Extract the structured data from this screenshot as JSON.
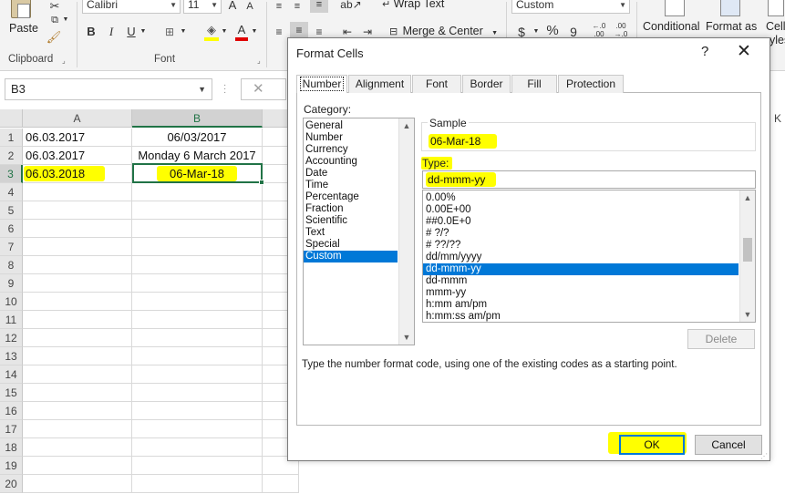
{
  "ribbon": {
    "paste_label": "Paste",
    "clipboard_label": "Clipboard",
    "font_group_label": "Font",
    "font_name": "Calibri",
    "font_size": "11",
    "bold": "B",
    "italic": "I",
    "underline": "U",
    "grow_font": "A",
    "shrink_font": "A",
    "font_color_letter": "A",
    "wrap_text": "Wrap Text",
    "merge_center": "Merge & Center",
    "number_format": "Custom",
    "currency_symbol": "$",
    "percent_symbol": "%",
    "comma_symbol": "9",
    "conditional_label": "Conditional",
    "format_as_label": "Format as",
    "cell_label": "Cell",
    "styles_label": "yles"
  },
  "formula_bar": {
    "name_box": "B3",
    "cancel_glyph": "✕"
  },
  "grid": {
    "columns": [
      "A",
      "B"
    ],
    "rows": [
      "1",
      "2",
      "3",
      "4",
      "5",
      "6",
      "7",
      "8",
      "9",
      "10",
      "11",
      "12",
      "13",
      "14",
      "15",
      "16",
      "17",
      "18",
      "19",
      "20"
    ],
    "a1": "06.03.2017",
    "b1": "06/03/2017",
    "a2": "06.03.2017",
    "b2": "Monday 6 March 2017",
    "a3": "06.03.2018",
    "b3": "06-Mar-18",
    "partial_column": "K"
  },
  "dialog": {
    "title": "Format Cells",
    "help": "?",
    "close": "✕",
    "tabs": [
      "Number",
      "Alignment",
      "Font",
      "Border",
      "Fill",
      "Protection"
    ],
    "category_label": "Category:",
    "categories": [
      "General",
      "Number",
      "Currency",
      "Accounting",
      "Date",
      "Time",
      "Percentage",
      "Fraction",
      "Scientific",
      "Text",
      "Special",
      "Custom"
    ],
    "selected_category": "Custom",
    "sample_label": "Sample",
    "sample_value": "06-Mar-18",
    "type_label": "Type:",
    "type_value": "dd-mmm-yy",
    "formats": [
      "0.00%",
      "0.00E+00",
      "##0.0E+0",
      "# ?/?",
      "# ??/??",
      "dd/mm/yyyy",
      "dd-mmm-yy",
      "dd-mmm",
      "mmm-yy",
      "h:mm am/pm",
      "h:mm:ss am/pm"
    ],
    "selected_format": "dd-mmm-yy",
    "delete_label": "Delete",
    "hint": "Type the number format code, using one of the existing codes as a starting point.",
    "ok_label": "OK",
    "cancel_label": "Cancel"
  },
  "colors": {
    "highlight": "#ffff00",
    "selection_blue": "#0078d7",
    "excel_green": "#217346"
  }
}
